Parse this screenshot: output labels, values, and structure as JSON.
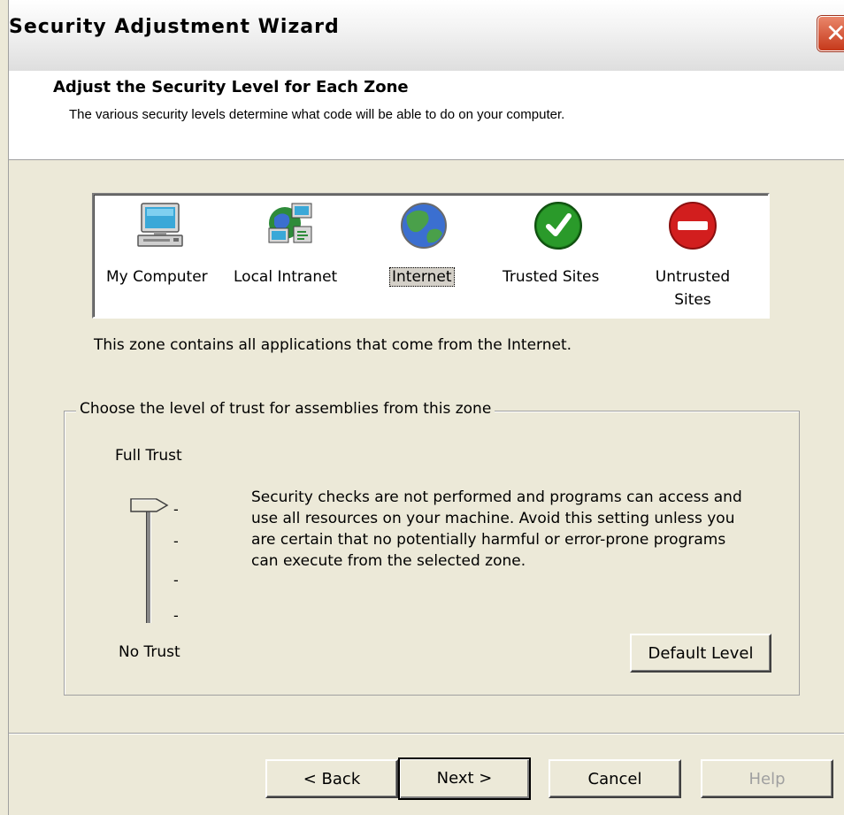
{
  "window": {
    "title": "Security Adjustment Wizard"
  },
  "header": {
    "title": "Adjust the Security Level for Each Zone",
    "subtitle": "The various security levels determine what code will be able to do on your computer."
  },
  "zones": [
    {
      "label": "My Computer",
      "icon": "computer-icon"
    },
    {
      "label": "Local Intranet",
      "icon": "network-icon"
    },
    {
      "label": "Internet",
      "icon": "globe-icon",
      "selected": true
    },
    {
      "label": "Trusted Sites",
      "icon": "checkmark-icon"
    },
    {
      "label_line1": "Untrusted",
      "label_line2": "Sites",
      "icon": "no-entry-icon"
    }
  ],
  "zone_description": "This zone contains all applications that come from the Internet.",
  "trust": {
    "group_title": "Choose the level of trust for assemblies from this zone",
    "top_label": "Full Trust",
    "bottom_label": "No Trust",
    "levels": 4,
    "selected_level": 4,
    "description": "Security checks are not performed and programs can access and use all resources on your machine.  Avoid this setting unless you are certain that no potentially harmful or error-prone programs can execute from the selected zone.",
    "default_button": "Default Level"
  },
  "buttons": {
    "back": "< Back",
    "next": "Next >",
    "cancel": "Cancel",
    "help": "Help"
  },
  "colors": {
    "face": "#ECE9D8",
    "white": "#FFFFFF",
    "close": "#C6391B"
  }
}
